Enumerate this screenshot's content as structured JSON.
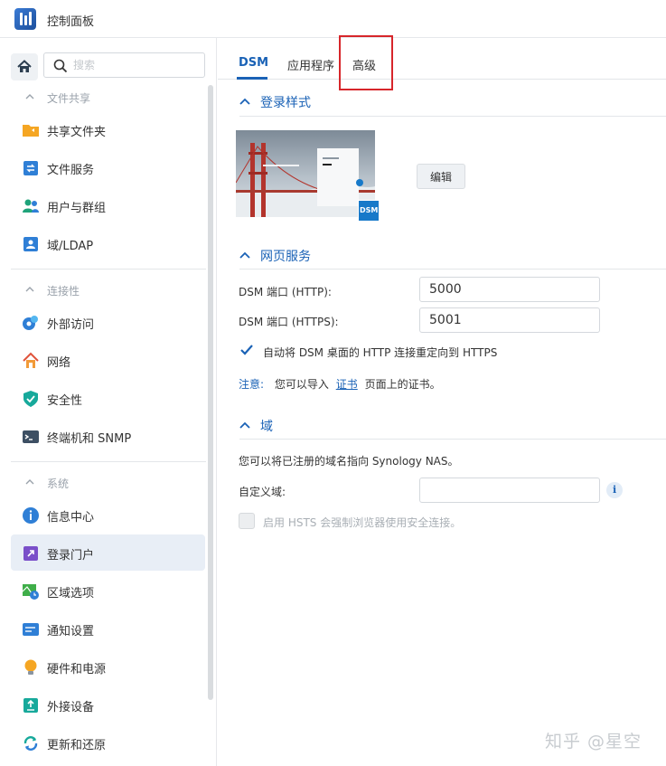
{
  "window": {
    "title": "控制面板"
  },
  "search": {
    "placeholder": "搜索"
  },
  "sidebar": {
    "sections": [
      {
        "label": "文件共享",
        "items": [
          {
            "label": "共享文件夹",
            "icon": "folder-share-icon"
          },
          {
            "label": "文件服务",
            "icon": "file-services-icon"
          },
          {
            "label": "用户与群组",
            "icon": "user-group-icon"
          },
          {
            "label": "域/LDAP",
            "icon": "domain-ldap-icon"
          }
        ]
      },
      {
        "label": "连接性",
        "items": [
          {
            "label": "外部访问",
            "icon": "external-access-icon"
          },
          {
            "label": "网络",
            "icon": "network-icon"
          },
          {
            "label": "安全性",
            "icon": "security-shield-icon"
          },
          {
            "label": "终端机和 SNMP",
            "icon": "terminal-icon"
          }
        ]
      },
      {
        "label": "系统",
        "items": [
          {
            "label": "信息中心",
            "icon": "info-center-icon"
          },
          {
            "label": "登录门户",
            "icon": "login-portal-icon",
            "active": true
          },
          {
            "label": "区域选项",
            "icon": "regional-options-icon"
          },
          {
            "label": "通知设置",
            "icon": "notification-icon"
          },
          {
            "label": "硬件和电源",
            "icon": "hardware-power-icon"
          },
          {
            "label": "外接设备",
            "icon": "external-devices-icon"
          },
          {
            "label": "更新和还原",
            "icon": "update-restore-icon"
          }
        ]
      }
    ]
  },
  "tabs": [
    {
      "label": "DSM",
      "active": true
    },
    {
      "label": "应用程序",
      "active": false
    },
    {
      "label": "高级",
      "active": false
    }
  ],
  "login_style": {
    "title": "登录样式",
    "edit_button": "编辑",
    "badge_text": "DSM"
  },
  "web_services": {
    "title": "网页服务",
    "http_label": "DSM 端口 (HTTP):",
    "http_value": "5000",
    "https_label": "DSM 端口 (HTTPS):",
    "https_value": "5001",
    "redirect_label": "自动将 DSM 桌面的 HTTP 连接重定向到 HTTPS",
    "redirect_checked": true,
    "note_key": "注意:",
    "note_before": "您可以导入",
    "note_link": "证书",
    "note_after": "页面上的证书。"
  },
  "domain": {
    "title": "域",
    "description": "您可以将已注册的域名指向 Synology NAS。",
    "custom_label": "自定义域:",
    "custom_value": "",
    "hsts_label": "启用 HSTS 会强制浏览器使用安全连接。",
    "hsts_checked": false
  },
  "watermark": "知乎 @星空",
  "colors": {
    "accent": "#1a62b6",
    "highlight_box": "#d7262b",
    "active_item_bg": "#e8eef6"
  }
}
